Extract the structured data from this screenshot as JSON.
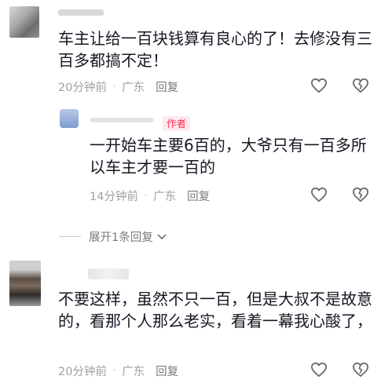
{
  "comments": [
    {
      "text": "车主让给一百块钱算有良心的了！去修没有三百多都搞不定！",
      "time": "20分钟前",
      "location": "广东",
      "reply_label": "回复",
      "icons": {
        "like": "heart-outline-icon",
        "dislike": "broken-heart-icon"
      }
    },
    {
      "is_author": true,
      "author_badge": "作者",
      "text": "一开始车主要6百的，大爷只有一百多所以车主才要一百的",
      "time": "14分钟前",
      "location": "广东",
      "reply_label": "回复",
      "icons": {
        "like": "heart-outline-icon",
        "dislike": "broken-heart-icon"
      }
    },
    {
      "text": "不要这样，虽然不只一百，但是大叔不是故意的，看那个人那么老实，看着一幕我心酸了，",
      "time": "20分钟前",
      "location": "广东",
      "reply_label": "回复",
      "icons": {
        "like": "heart-outline-icon",
        "dislike": "broken-heart-icon"
      }
    }
  ],
  "expand_replies": {
    "label": "展开1条回复",
    "icon": "chevron-down-icon"
  },
  "colors": {
    "badge_text": "#fe2c55",
    "badge_bg": "#fde9ee",
    "meta": "#a0a0a5"
  }
}
